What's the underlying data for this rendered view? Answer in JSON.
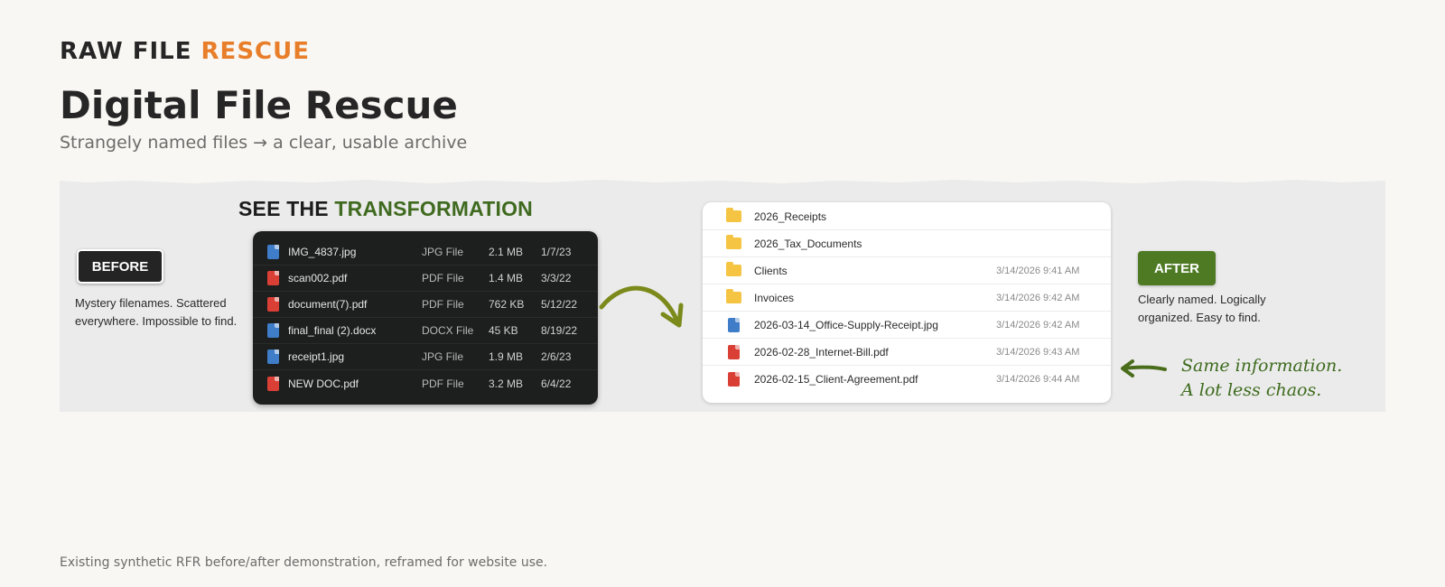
{
  "header": {
    "brand_primary": "RAW FILE",
    "brand_accent": "RESCUE",
    "title": "Digital File Rescue",
    "subtitle": "Strangely named files → a clear, usable archive"
  },
  "banner": {
    "heading_prefix": "SEE THE",
    "heading_accent": "TRANSFORMATION",
    "before": {
      "badge": "BEFORE",
      "description": "Mystery filenames. Scattered everywhere. Impossible to find.",
      "files": [
        {
          "icon": "image-file-icon",
          "name": "IMG_4837.jpg",
          "type": "JPG File",
          "size": "2.1 MB",
          "date": "1/7/23"
        },
        {
          "icon": "pdf-file-icon",
          "name": "scan002.pdf",
          "type": "PDF File",
          "size": "1.4 MB",
          "date": "3/3/22"
        },
        {
          "icon": "pdf-file-icon",
          "name": "document(7).pdf",
          "type": "PDF File",
          "size": "762 KB",
          "date": "5/12/22"
        },
        {
          "icon": "word-file-icon",
          "name": "final_final (2).docx",
          "type": "DOCX File",
          "size": "45 KB",
          "date": "8/19/22"
        },
        {
          "icon": "image-file-icon",
          "name": "receipt1.jpg",
          "type": "JPG File",
          "size": "1.9 MB",
          "date": "2/6/23"
        },
        {
          "icon": "pdf-file-icon",
          "name": "NEW DOC.pdf",
          "type": "PDF File",
          "size": "3.2 MB",
          "date": "6/4/22"
        }
      ]
    },
    "after": {
      "badge": "AFTER",
      "description": "Clearly named. Logically organized. Easy to find.",
      "items": [
        {
          "kind": "folder",
          "icon": "folder-icon",
          "name": "2026_Receipts",
          "date": ""
        },
        {
          "kind": "folder",
          "icon": "folder-icon",
          "name": "2026_Tax_Documents",
          "date": ""
        },
        {
          "kind": "folder",
          "icon": "folder-icon",
          "name": "Clients",
          "date": "3/14/2026 9:41 AM"
        },
        {
          "kind": "folder",
          "icon": "folder-icon",
          "name": "Invoices",
          "date": "3/14/2026 9:42 AM"
        },
        {
          "kind": "image",
          "icon": "image-file-icon",
          "name": "2026-03-14_Office-Supply-Receipt.jpg",
          "date": "3/14/2026 9:42 AM"
        },
        {
          "kind": "pdf",
          "icon": "pdf-file-icon",
          "name": "2026-02-28_Internet-Bill.pdf",
          "date": "3/14/2026 9:43 AM"
        },
        {
          "kind": "pdf",
          "icon": "pdf-file-icon",
          "name": "2026-02-15_Client-Agreement.pdf",
          "date": "3/14/2026 9:44 AM"
        }
      ]
    },
    "note_line1": "Same information.",
    "note_line2": "A lot less chaos."
  },
  "caption": "Existing synthetic RFR before/after demonstration, reframed for website use.",
  "colors": {
    "accent_orange": "#e87e2a",
    "accent_green": "#4d7a23",
    "text_dark": "#262626"
  }
}
